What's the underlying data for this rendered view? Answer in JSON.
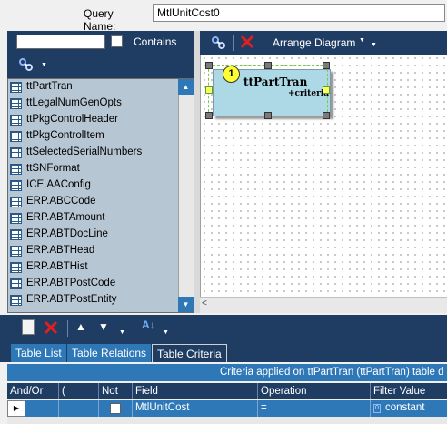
{
  "query": {
    "label": "Query Name:",
    "value": "MtlUnitCost0"
  },
  "left_panel": {
    "search_value": "",
    "contains_label": "Contains",
    "tables": [
      "ttPartTran",
      "ttLegalNumGenOpts",
      "ttPkgControlHeader",
      "ttPkgControlItem",
      "ttSelectedSerialNumbers",
      "ttSNFormat",
      "ICE.AAConfig",
      "ERP.ABCCode",
      "ERP.ABTAmount",
      "ERP.ABTDocLine",
      "ERP.ABTHead",
      "ERP.ABTHist",
      "ERP.ABTPostCode",
      "ERP.ABTPostEntity"
    ]
  },
  "diagram": {
    "arrange_label": "Arrange Diagram",
    "node": {
      "title": "ttPartTran",
      "subtitle": "+criteria",
      "number": "1"
    }
  },
  "tabs": [
    {
      "label": "Table List",
      "active": false
    },
    {
      "label": "Table Relations",
      "active": false
    },
    {
      "label": "Table Criteria",
      "active": true
    }
  ],
  "grid": {
    "caption": "Criteria applied on ttPartTran (ttPartTran)  table d",
    "columns": [
      "And/Or",
      "(",
      "Not",
      "Field",
      "Operation",
      "Filter Value"
    ],
    "rows": [
      {
        "and_or": "",
        "paren": "",
        "not": false,
        "field": "MtlUnitCost",
        "operation": "=",
        "filter_value": "constant",
        "filter_icon": "0"
      }
    ]
  },
  "colors": {
    "navy": "#1f3c62",
    "blue": "#2f78b7",
    "list_bg": "#b7c6d3",
    "node_bg": "#add8e6",
    "badge": "#ffff33",
    "delete_red": "#e02020"
  }
}
